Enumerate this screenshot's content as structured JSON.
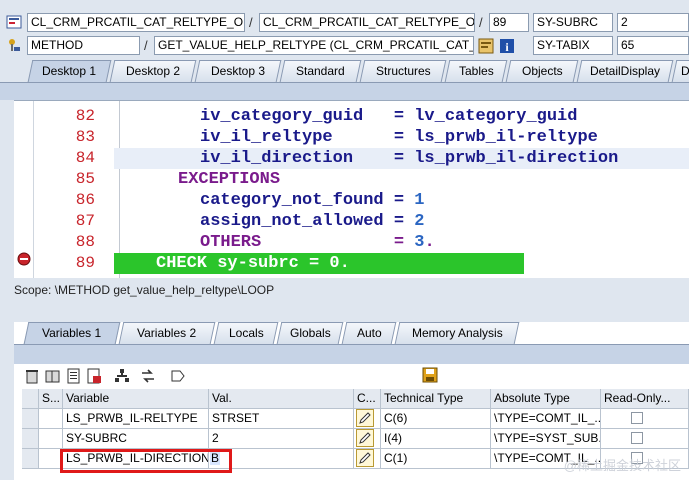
{
  "header": {
    "row1": {
      "field1": "CL_CRM_PRCATIL_CAT_RELTYPE_OB...",
      "field2": "CL_CRM_PRCATIL_CAT_RELTYPE_OB...",
      "line": "89",
      "var_name": "SY-SUBRC",
      "var_value": "2"
    },
    "row2": {
      "type": "METHOD",
      "method": "GET_VALUE_HELP_RELTYPE (CL_CRM_PRCATIL_CAT_R...",
      "var_name": "SY-TABIX",
      "var_value": "65"
    }
  },
  "desktop_tabs": [
    "Desktop 1",
    "Desktop 2",
    "Desktop 3",
    "Standard",
    "Structures",
    "Tables",
    "Objects",
    "DetailDisplay",
    "D"
  ],
  "code": {
    "lines": [
      {
        "no": "82",
        "text": "iv_category_guid   = lv_category_guid"
      },
      {
        "no": "83",
        "text": "iv_il_reltype      = ls_prwb_il-reltype"
      },
      {
        "no": "84",
        "text": "iv_il_direction    = ls_prwb_il-direction"
      },
      {
        "no": "85",
        "text": "EXCEPTIONS"
      },
      {
        "no": "86",
        "text": "category_not_found = 1"
      },
      {
        "no": "87",
        "text": "assign_not_allowed = 2"
      },
      {
        "no": "88",
        "text": "OTHERS             = 3."
      },
      {
        "no": "89",
        "text": "CHECK sy-subrc = 0."
      }
    ]
  },
  "scope": "Scope: \\METHOD get_value_help_reltype\\LOOP",
  "var_tabs": [
    "Variables 1",
    "Variables 2",
    "Locals",
    "Globals",
    "Auto",
    "Memory Analysis"
  ],
  "table": {
    "headers": [
      "S...",
      "Variable",
      "Val.",
      "C...",
      "Technical Type",
      "Absolute Type",
      "Read-Only..."
    ],
    "rows": [
      {
        "variable": "LS_PRWB_IL-RELTYPE",
        "value": "STRSET",
        "tech": "C(6)",
        "abs": "\\TYPE=COMT_IL_..."
      },
      {
        "variable": "SY-SUBRC",
        "value": "2",
        "tech": "I(4)",
        "abs": "\\TYPE=SYST_SUB..."
      },
      {
        "variable": "LS_PRWB_IL-DIRECTION",
        "value": "B",
        "tech": "C(1)",
        "abs": "\\TYPE=COMT_IL_..."
      }
    ]
  },
  "watermark": "@稀土掘金技术社区",
  "colors": {
    "current_line": "#2bc52b",
    "highlight_box": "#e01919",
    "keyword": "#7a1b8c",
    "number": "#2b66c2"
  }
}
